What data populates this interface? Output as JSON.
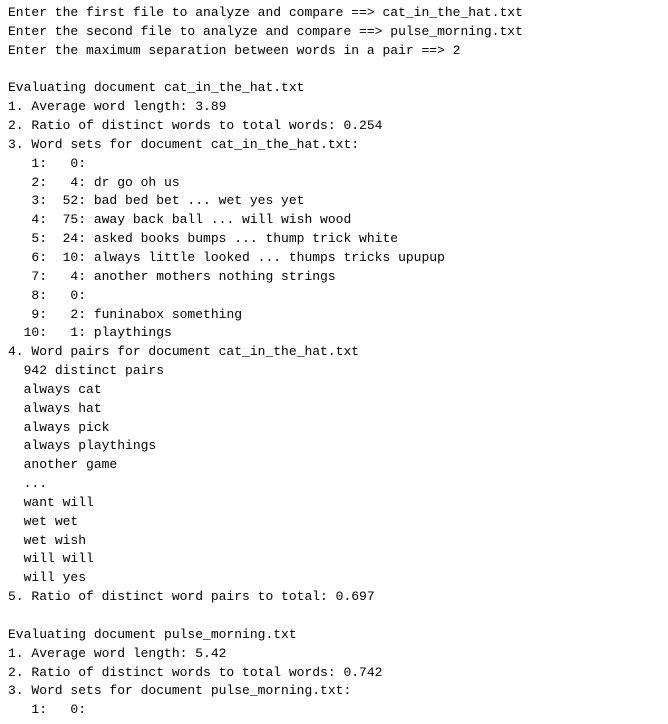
{
  "terminal": {
    "lines": [
      "Enter the first file to analyze and compare ==> cat_in_the_hat.txt",
      "Enter the second file to analyze and compare ==> pulse_morning.txt",
      "Enter the maximum separation between words in a pair ==> 2",
      "",
      "Evaluating document cat_in_the_hat.txt",
      "1. Average word length: 3.89",
      "2. Ratio of distinct words to total words: 0.254",
      "3. Word sets for document cat_in_the_hat.txt:",
      "   1:   0:",
      "   2:   4: dr go oh us",
      "   3:  52: bad bed bet ... wet yes yet",
      "   4:  75: away back ball ... will wish wood",
      "   5:  24: asked books bumps ... thump trick white",
      "   6:  10: always little looked ... thumps tricks upupup",
      "   7:   4: another mothers nothing strings",
      "   8:   0:",
      "   9:   2: funinabox something",
      "  10:   1: playthings",
      "4. Word pairs for document cat_in_the_hat.txt",
      "  942 distinct pairs",
      "  always cat",
      "  always hat",
      "  always pick",
      "  always playthings",
      "  another game",
      "  ...",
      "  want will",
      "  wet wet",
      "  wet wish",
      "  will will",
      "  will yes",
      "5. Ratio of distinct word pairs to total: 0.697",
      "",
      "Evaluating document pulse_morning.txt",
      "1. Average word length: 5.42",
      "2. Ratio of distinct words to total words: 0.742",
      "3. Word sets for document pulse_morning.txt:",
      "   1:   0:"
    ]
  }
}
